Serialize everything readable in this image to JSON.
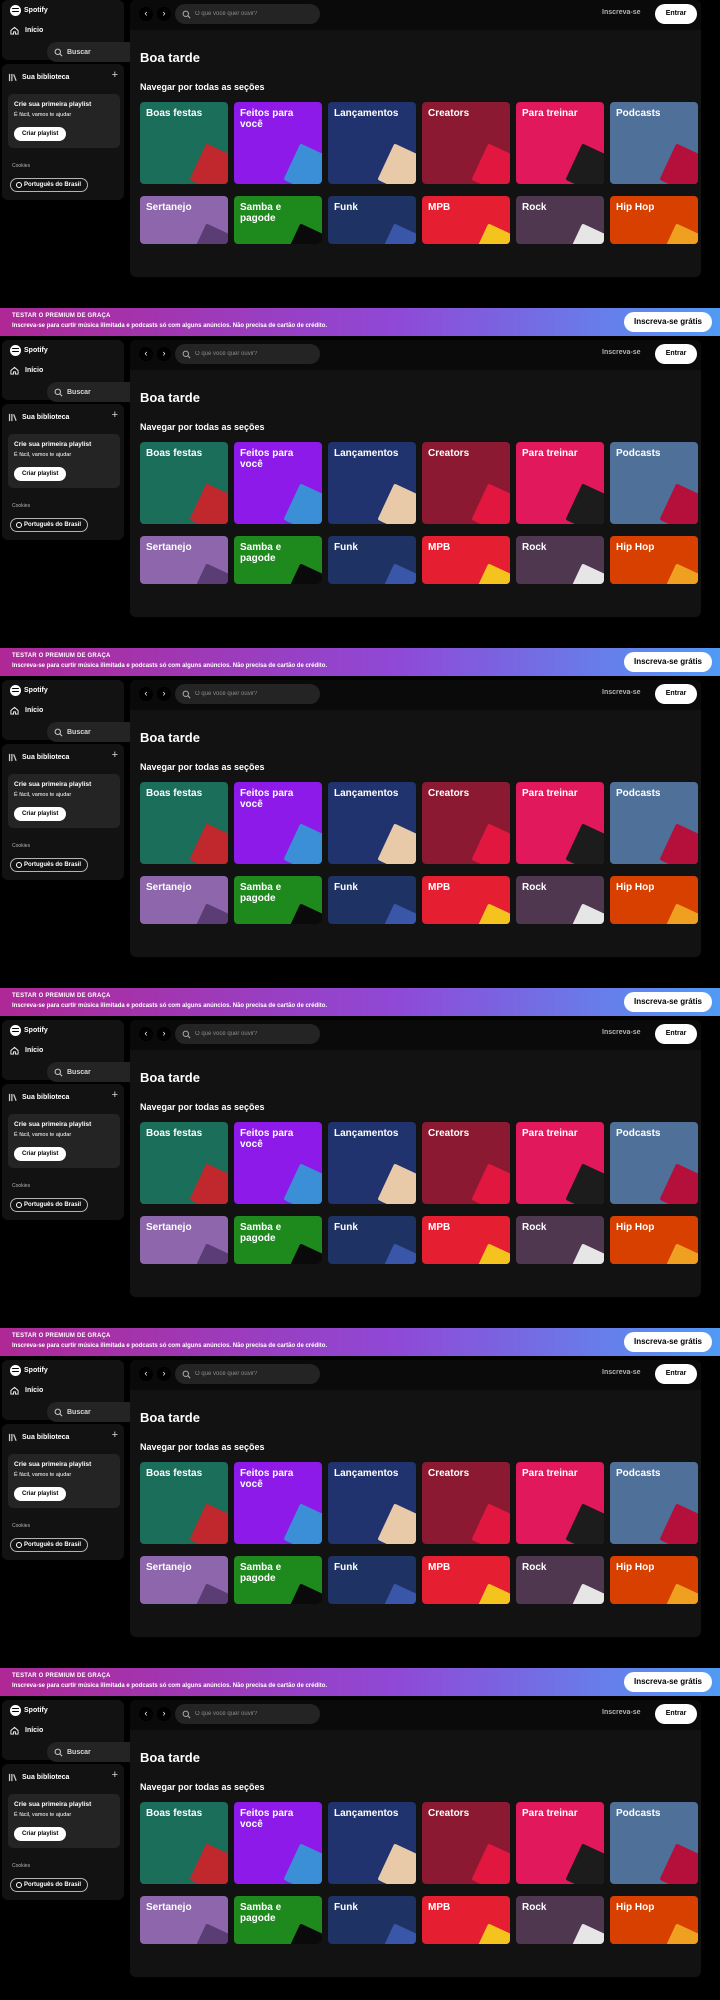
{
  "banner": {
    "title": "TESTAR O PREMIUM DE GRAÇA",
    "text": "Inscreva-se para curtir música ilimitada e podcasts só com alguns anúncios. Não precisa de cartão de crédito.",
    "button": "Inscreva-se grátis"
  },
  "nav": {
    "logo": "Spotify",
    "home": "Início",
    "search": "Buscar"
  },
  "library": {
    "title": "Sua biblioteca",
    "card_title": "Crie sua primeira playlist",
    "card_sub": "É fácil, vamos te ajudar",
    "card_button": "Criar playlist",
    "cookies": "Cookies",
    "language": "Português do Brasil"
  },
  "topbar": {
    "search_placeholder": "O que você quer ouvir?",
    "signup": "Inscreva-se",
    "login": "Entrar"
  },
  "main": {
    "greeting": "Boa tarde",
    "section": "Navegar por todas as seções"
  },
  "categories": [
    {
      "label": "Boas festas",
      "color": "#1b6e5a",
      "art": "#c0282d"
    },
    {
      "label": "Feitos para você",
      "color": "#8d1ae8",
      "art": "#3a8fd6"
    },
    {
      "label": "Lançamentos",
      "color": "#21336e",
      "art": "#e8c9a8"
    },
    {
      "label": "Creators",
      "color": "#8c1932",
      "art": "#e1173f"
    },
    {
      "label": "Para treinar",
      "color": "#e1185c",
      "art": "#1c1c1c"
    },
    {
      "label": "Podcasts",
      "color": "#4f7099",
      "art": "#b5103c"
    },
    {
      "label": "Sertanejo",
      "color": "#8e66ac",
      "art": "#5a3d75"
    },
    {
      "label": "Samba e pagode",
      "color": "#1e8a1e",
      "art": "#0a0a0a"
    },
    {
      "label": "Funk",
      "color": "#1e3264",
      "art": "#3a56a8"
    },
    {
      "label": "MPB",
      "color": "#e61e32",
      "art": "#f5c31e"
    },
    {
      "label": "Rock",
      "color": "#503750",
      "art": "#e6e6e6"
    },
    {
      "label": "Hip Hop",
      "color": "#d84000",
      "art": "#f0a020"
    }
  ]
}
